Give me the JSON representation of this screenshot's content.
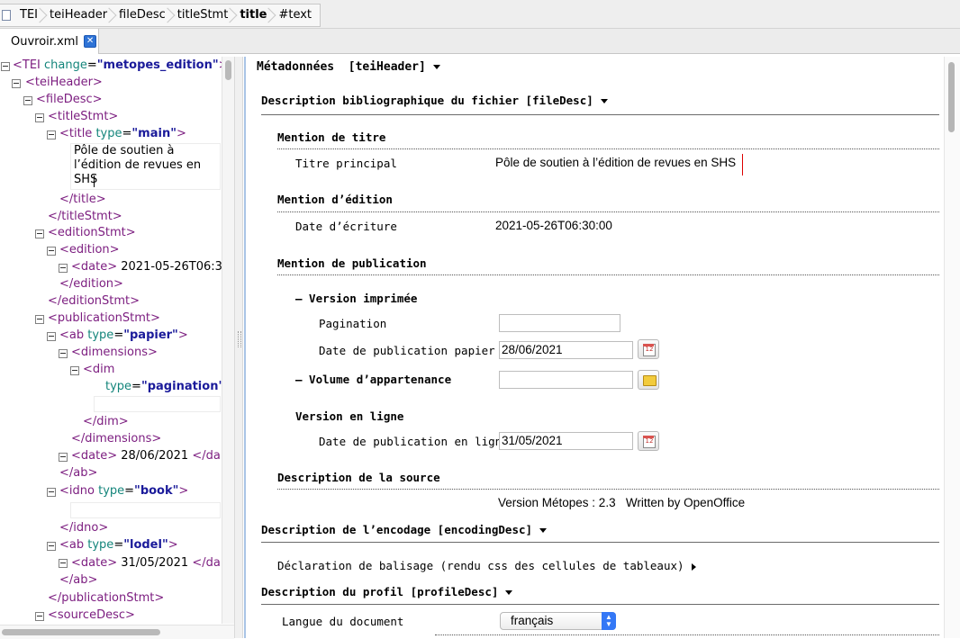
{
  "breadcrumb": {
    "items": [
      "TEI",
      "teiHeader",
      "fileDesc",
      "titleStmt",
      "title",
      "#text"
    ]
  },
  "tab": {
    "label": "Ouvroir.xml"
  },
  "tree": {
    "tei_tag": "<TEI",
    "tei_attr": "change",
    "tei_eq": "=",
    "tei_val": "\"metopes_edition\"",
    "tei_close": ">",
    "teiheader": "<teiHeader>",
    "filedesc": "<fileDesc>",
    "titlestmt": "<titleStmt>",
    "title_tag": "<title",
    "title_attr": "type",
    "title_eq": "=",
    "title_val": "\"main\"",
    "title_close": ">",
    "title_text_1": "Pôle de soutien à",
    "title_text_2": "l’édition de revues en",
    "title_text_3": "SHS",
    "title_end": "</title>",
    "titlestmt_end": "</titleStmt>",
    "editionstmt": "<editionStmt>",
    "edition": "<edition>",
    "date1_tag": "<date>",
    "date1_text": "2021-05-26T06:3",
    "edition_end": "</edition>",
    "editionstmt_end": "</editionStmt>",
    "publicationstmt": "<publicationStmt>",
    "ab1_tag": "<ab",
    "ab1_attr": "type",
    "ab1_eq": "=",
    "ab1_val": "\"papier\"",
    "ab1_close": ">",
    "dimensions": "<dimensions>",
    "dim_tag": "<dim",
    "dim_attr": "type",
    "dim_eq": "=",
    "dim_val": "\"pagination\"",
    "dim_close": ":",
    "dim_end": "</dim>",
    "dimensions_end": "</dimensions>",
    "date2_tag": "<date>",
    "date2_text": "28/06/2021",
    "date2_end": "</da",
    "ab1_end": "</ab>",
    "idno_tag": "<idno",
    "idno_attr": "type",
    "idno_eq": "=",
    "idno_val": "\"book\"",
    "idno_close": ">",
    "idno_end": "</idno>",
    "ab2_tag": "<ab",
    "ab2_attr": "type",
    "ab2_eq": "=",
    "ab2_val": "\"lodel\"",
    "ab2_close": ">",
    "date3_tag": "<date>",
    "date3_text": "31/05/2021",
    "date3_end": "</da",
    "ab2_end": "</ab>",
    "publicationstmt_end": "</publicationStmt>",
    "sourcedesc": "<sourceDesc>"
  },
  "form": {
    "metadata_heading": "Métadonnées  [teiHeader]",
    "filedesc_heading": "Description bibliographique du fichier [fileDesc]",
    "title_section": "Mention de titre",
    "title_label": "Titre principal",
    "title_value": "Pôle de soutien à l’édition de revues en SHS",
    "edition_section": "Mention d’édition",
    "date_label": "Date d’écriture",
    "date_value": "2021-05-26T06:30:00",
    "publication_section": "Mention de publication",
    "print_version": "– Version imprimée",
    "pagination_label": "Pagination",
    "pagination_value": "",
    "print_date_label": "Date de publication papier",
    "print_date_value": "28/06/2021",
    "volume_label": "– Volume d’appartenance",
    "volume_value": "",
    "online_version": "Version en ligne",
    "online_date_label": "Date de publication en ligne",
    "online_date_value": "31/05/2021",
    "source_section": "Description de la source",
    "source_value": "Version Métopes : 2.3   Written by OpenOffice",
    "encoding_heading": "Description de l’encodage [encodingDesc]",
    "markup_decl": "Déclaration de balisage (rendu css des cellules de tableaux)",
    "profile_heading": "Description du profil [profileDesc]",
    "language_label": "Langue du document",
    "language_value": "français",
    "calendar_icon_text": "12"
  },
  "colors": {
    "tag": "#7b1c7f",
    "attr_name": "#14857b",
    "attr_value": "#1a1a9a",
    "accent": "#3478f6",
    "panel_border": "#a9c4e6"
  },
  "icons": [
    "document-icon",
    "close-icon",
    "collapse-icon",
    "calendar-icon",
    "folder-icon",
    "chevron-down-icon",
    "chevron-right-icon"
  ]
}
